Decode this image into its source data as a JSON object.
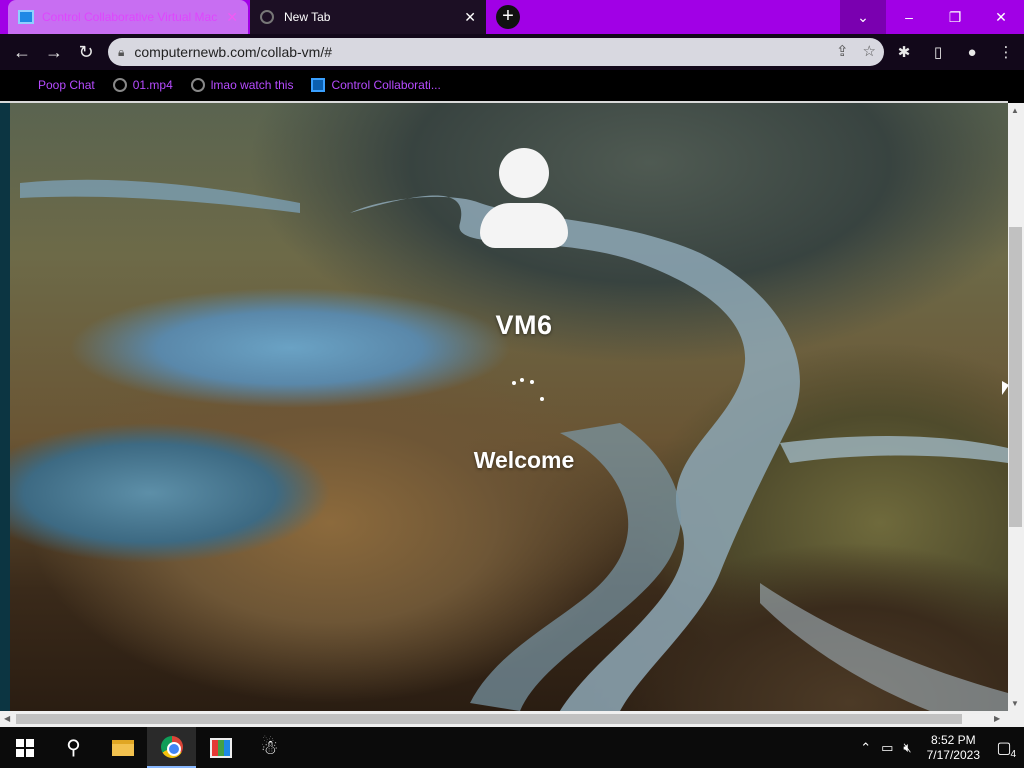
{
  "browser": {
    "tabs": [
      {
        "title": "Control Collaborative Virtual Mac",
        "favicon": "monitor-icon",
        "active": true
      },
      {
        "title": "New Tab",
        "favicon": "globe-icon",
        "active": false
      }
    ],
    "new_tab_symbol": "+",
    "window_controls": {
      "dropdown": "⌄",
      "minimize": "–",
      "restore": "❐",
      "close": "✕"
    },
    "url": "computernewb.com/collab-vm/#",
    "bookmarks": [
      {
        "label": "Poop Chat",
        "icon": "none"
      },
      {
        "label": "01.mp4",
        "icon": "globe-icon"
      },
      {
        "label": "lmao watch this",
        "icon": "globe-icon"
      },
      {
        "label": "Control Collaborati...",
        "icon": "monitor-icon"
      }
    ],
    "accent_color": "#a100e6"
  },
  "vm_screen": {
    "machine_name": "VM6",
    "status_text": "Welcome",
    "avatar_icon": "user-icon",
    "loading_indicator": "spinner-icon"
  },
  "taskbar": {
    "items": [
      "start-icon",
      "search-icon",
      "file-explorer-icon",
      "chrome-icon",
      "paint-icon",
      "app-icon"
    ],
    "active_item": "chrome-icon",
    "tray": {
      "time": "8:52 PM",
      "date": "7/17/2023",
      "notification_count": "4"
    }
  }
}
